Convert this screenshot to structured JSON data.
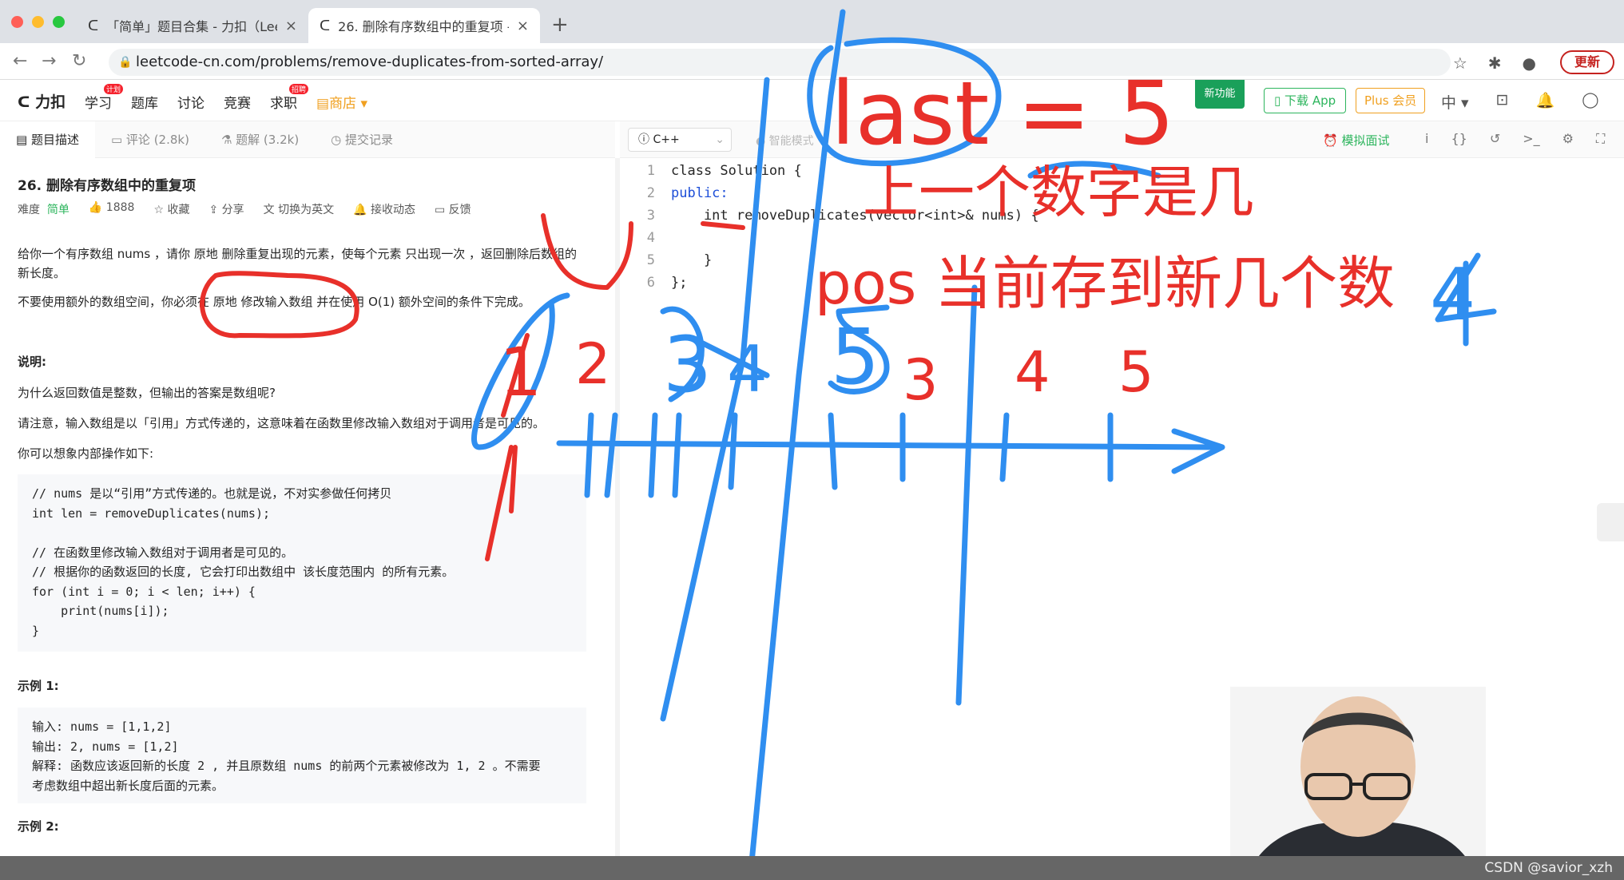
{
  "browser": {
    "tabs": [
      {
        "title": "「简单」题目合集 - 力扣（Leet",
        "active": false
      },
      {
        "title": "26. 删除有序数组中的重复项 - 力",
        "active": true
      }
    ],
    "url": "leetcode-cn.com/problems/remove-duplicates-from-sorted-array/",
    "update_label": "更新"
  },
  "header": {
    "logo": "力扣",
    "nav": [
      {
        "label": "学习",
        "badge": "计划"
      },
      {
        "label": "题库"
      },
      {
        "label": "讨论"
      },
      {
        "label": "竞赛"
      },
      {
        "label": "求职",
        "badge": "招聘"
      },
      {
        "label": "商店"
      }
    ],
    "new_feature": "新功能",
    "download_app": "下载 App",
    "plus": "Plus 会员",
    "lang": "中"
  },
  "left_tabs": [
    {
      "label": "题目描述",
      "active": true
    },
    {
      "label": "评论 (2.8k)"
    },
    {
      "label": "题解 (3.2k)"
    },
    {
      "label": "提交记录"
    }
  ],
  "problem": {
    "title": "26. 删除有序数组中的重复项",
    "difficulty_label": "难度",
    "difficulty": "简单",
    "likes": "1888",
    "actions": [
      "收藏",
      "分享",
      "切换为英文",
      "接收动态",
      "反馈"
    ],
    "desc1": "给你一个有序数组 nums ，请你 原地 删除重复出现的元素，使每个元素 只出现一次 ，返回删除后数组的新长度。",
    "desc2": "不要使用额外的数组空间，你必须在 原地 修改输入数组 并在使用 O(1) 额外空间的条件下完成。",
    "explain_heading": "说明:",
    "explain1": "为什么返回数值是整数，但输出的答案是数组呢?",
    "explain2": "请注意，输入数组是以「引用」方式传递的，这意味着在函数里修改输入数组对于调用者是可见的。",
    "explain3": "你可以想象内部操作如下:",
    "code_sample": "// nums 是以“引用”方式传递的。也就是说，不对实参做任何拷贝\nint len = removeDuplicates(nums);\n\n// 在函数里修改输入数组对于调用者是可见的。\n// 根据你的函数返回的长度, 它会打印出数组中 该长度范围内 的所有元素。\nfor (int i = 0; i < len; i++) {\n    print(nums[i]);\n}",
    "example1_heading": "示例 1:",
    "example1": "输入: nums = [1,1,2]\n输出: 2, nums = [1,2]\n解释: 函数应该返回新的长度 2 , 并且原数组 nums 的前两个元素被修改为 1, 2 。不需要\n考虑数组中超出新长度后面的元素。",
    "example2_heading": "示例 2:"
  },
  "editor": {
    "language": "C++",
    "smart_mode": "智能模式",
    "mock_interview": "模拟面试",
    "lines": [
      {
        "n": "1",
        "text": "class Solution {"
      },
      {
        "n": "2",
        "text": "public:"
      },
      {
        "n": "3",
        "text": "    int removeDuplicates(vector<int>& nums) {"
      },
      {
        "n": "4",
        "text": ""
      },
      {
        "n": "5",
        "text": "    }"
      },
      {
        "n": "6",
        "text": "};"
      }
    ]
  },
  "annotations": {
    "last_label": "last = 5",
    "last_note": "上一个数字是几",
    "pos_note": "pos 当前存到新几个数",
    "pos_value": "4",
    "sequence": [
      "1",
      "2",
      "3",
      "4",
      "5",
      "3",
      "4",
      "5"
    ]
  },
  "watermark": "CSDN @savior_xzh",
  "colors": {
    "ink_red": "#e8302a",
    "ink_blue": "#2f8ef0",
    "easy_green": "#2db55d"
  }
}
